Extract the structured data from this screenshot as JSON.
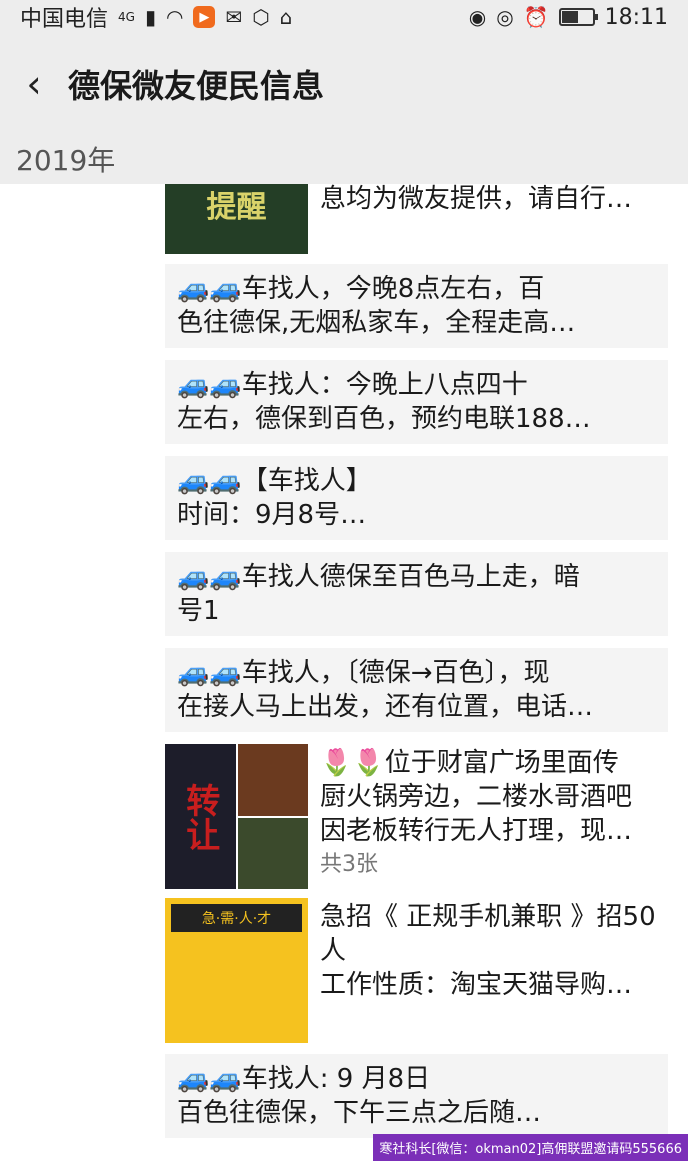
{
  "status_bar": {
    "carrier": "中国电信",
    "network": "4G",
    "time": "18:11",
    "battery_level": 0.55
  },
  "nav": {
    "title": "德保微友便民信息"
  },
  "year_label": "2019年",
  "posts": [
    {
      "kind": "image",
      "lines": [
        "息均为微友提供，请自行…"
      ],
      "thumb_text": "提醒"
    },
    {
      "kind": "text",
      "lines": [
        "🚙🚙车找人，今晚8点左右，百",
        "色往德保,无烟私家车，全程走高…"
      ]
    },
    {
      "kind": "text",
      "lines": [
        "🚙🚙车找人：今晚上八点四十",
        "左右，德保到百色，预约电联188…"
      ]
    },
    {
      "kind": "text",
      "lines": [
        "🚙🚙【车找人】",
        "时间：9月8号…"
      ]
    },
    {
      "kind": "text",
      "lines": [
        "🚙🚙车找人德保至百色马上走，暗",
        "号1"
      ]
    },
    {
      "kind": "text",
      "lines": [
        "🚙🚙车找人，〔德保→百色〕，现",
        "在接人马上出发，还有位置，电话…"
      ]
    },
    {
      "kind": "image",
      "lines": [
        "🌷🌷位于财富广场里面传",
        "厨火锅旁边，二楼水哥酒吧",
        "因老板转行无人打理，现…"
      ],
      "photo_count": "共3张",
      "thumb_text": "转让"
    },
    {
      "kind": "image",
      "lines": [
        "急招《 正规手机兼职 》招50",
        "人",
        "工作性质：淘宝天猫导购…"
      ],
      "thumb_text": "急·需·人·才"
    },
    {
      "kind": "text",
      "lines": [
        "🚙🚙车找人: 9 月8日",
        "    百色往德保，下午三点之后随…"
      ]
    }
  ],
  "watermark": "寒社科长[微信：okman02]高佣联盟邀请码555666",
  "colors": {
    "header_bg": "#ededed",
    "card_bg": "#f4f4f4",
    "car_blue": "#1e5fb5",
    "watermark_bg": "#7b2fb8"
  }
}
